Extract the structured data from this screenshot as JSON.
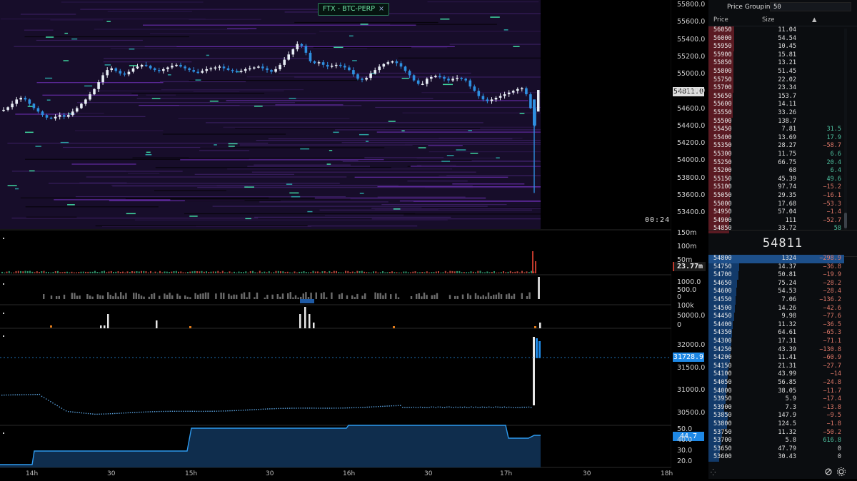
{
  "symbol_tab": {
    "label": "FTX - BTC-PERP",
    "close": "×"
  },
  "countdown": "00:24",
  "price_axis": {
    "ticks": [
      "55800.0",
      "55600.0",
      "55400.0",
      "55200.0",
      "55000.0",
      "54800.0",
      "54600.0",
      "54400.0",
      "54200.0",
      "54000.0",
      "53800.0",
      "53600.0",
      "53400.0"
    ],
    "current_tag": "54811.0"
  },
  "volume_panel": {
    "ticks": [
      "150m",
      "100m",
      "50m"
    ],
    "tag": "23.77m"
  },
  "panel2": {
    "ticks": [
      "1000.0",
      "500.0",
      "0"
    ],
    "top_cut": "1000"
  },
  "panel3": {
    "ticks": [
      "100k",
      "50000.0",
      "0"
    ]
  },
  "panel4": {
    "ticks": [
      "32000.0",
      "31500.0",
      "31000.0",
      "30500.0"
    ],
    "tag": "31728.9"
  },
  "panel5": {
    "ticks": [
      "50.0",
      "40.0",
      "30.0",
      "20.0"
    ],
    "tag": "44.7"
  },
  "time_axis": {
    "labels": [
      "14h",
      "30",
      "15h",
      "30",
      "16h",
      "30",
      "17h",
      "30",
      "18h"
    ]
  },
  "orderbook": {
    "grouping_label": "Price Grouping",
    "grouping_value": "50",
    "col_price": "Price",
    "col_size": "Size",
    "sort_icon": "▲",
    "mid_price": "54811",
    "asks": [
      {
        "price": "56050",
        "size": "11.04",
        "delta": ""
      },
      {
        "price": "56000",
        "size": "54.54",
        "delta": ""
      },
      {
        "price": "55950",
        "size": "10.45",
        "delta": ""
      },
      {
        "price": "55900",
        "size": "15.81",
        "delta": ""
      },
      {
        "price": "55850",
        "size": "13.21",
        "delta": ""
      },
      {
        "price": "55800",
        "size": "51.45",
        "delta": ""
      },
      {
        "price": "55750",
        "size": "22.02",
        "delta": ""
      },
      {
        "price": "55700",
        "size": "23.34",
        "delta": ""
      },
      {
        "price": "55650",
        "size": "153.7",
        "delta": ""
      },
      {
        "price": "55600",
        "size": "14.11",
        "delta": ""
      },
      {
        "price": "55550",
        "size": "33.26",
        "delta": ""
      },
      {
        "price": "55500",
        "size": "138.7",
        "delta": ""
      },
      {
        "price": "55450",
        "size": "7.81",
        "delta": "31.5"
      },
      {
        "price": "55400",
        "size": "13.69",
        "delta": "17.9"
      },
      {
        "price": "55350",
        "size": "28.27",
        "delta": "−58.7"
      },
      {
        "price": "55300",
        "size": "11.75",
        "delta": "6.6"
      },
      {
        "price": "55250",
        "size": "66.75",
        "delta": "20.4"
      },
      {
        "price": "55200",
        "size": "68",
        "delta": "6.4"
      },
      {
        "price": "55150",
        "size": "45.39",
        "delta": "49.6"
      },
      {
        "price": "55100",
        "size": "97.74",
        "delta": "−15.2"
      },
      {
        "price": "55050",
        "size": "29.35",
        "delta": "−16.1"
      },
      {
        "price": "55000",
        "size": "17.68",
        "delta": "−53.3"
      },
      {
        "price": "54950",
        "size": "57.04",
        "delta": "−1.4"
      },
      {
        "price": "54900",
        "size": "111",
        "delta": "−52.7"
      },
      {
        "price": "54850",
        "size": "33.72",
        "delta": "58"
      }
    ],
    "bids": [
      {
        "price": "54800",
        "size": "1324",
        "delta": "−298.9"
      },
      {
        "price": "54750",
        "size": "14.37",
        "delta": "−36.8"
      },
      {
        "price": "54700",
        "size": "50.81",
        "delta": "−19.9"
      },
      {
        "price": "54650",
        "size": "75.24",
        "delta": "−28.2"
      },
      {
        "price": "54600",
        "size": "54.53",
        "delta": "−28.4"
      },
      {
        "price": "54550",
        "size": "7.06",
        "delta": "−136.2"
      },
      {
        "price": "54500",
        "size": "14.26",
        "delta": "−42.6"
      },
      {
        "price": "54450",
        "size": "9.98",
        "delta": "−77.6"
      },
      {
        "price": "54400",
        "size": "11.32",
        "delta": "−36.5"
      },
      {
        "price": "54350",
        "size": "64.61",
        "delta": "−65.3"
      },
      {
        "price": "54300",
        "size": "17.31",
        "delta": "−71.1"
      },
      {
        "price": "54250",
        "size": "43.39",
        "delta": "−130.8"
      },
      {
        "price": "54200",
        "size": "11.41",
        "delta": "−60.9"
      },
      {
        "price": "54150",
        "size": "21.31",
        "delta": "−27.7"
      },
      {
        "price": "54100",
        "size": "43.99",
        "delta": "−14"
      },
      {
        "price": "54050",
        "size": "56.85",
        "delta": "−24.8"
      },
      {
        "price": "54000",
        "size": "38.05",
        "delta": "−11.7"
      },
      {
        "price": "53950",
        "size": "5.9",
        "delta": "−17.4"
      },
      {
        "price": "53900",
        "size": "7.3",
        "delta": "−13.8"
      },
      {
        "price": "53850",
        "size": "147.9",
        "delta": "−9.5"
      },
      {
        "price": "53800",
        "size": "124.5",
        "delta": "−1.8"
      },
      {
        "price": "53750",
        "size": "11.32",
        "delta": "−50.2"
      },
      {
        "price": "53700",
        "size": "5.8",
        "delta": "616.8"
      },
      {
        "price": "53650",
        "size": "47.79",
        "delta": "0"
      },
      {
        "price": "53600",
        "size": "30.43",
        "delta": "0"
      }
    ]
  },
  "colors": {
    "ask_bar": "#5a1a22",
    "bid_bar": "#123a6a",
    "bid_highlight": "#1d4f8a",
    "up_candle": "#e8eef5",
    "down_candle": "#2e8fe0",
    "accent": "#1e88e5",
    "delta_pos": "#4fc3a1",
    "delta_neg": "#e27a6a"
  }
}
